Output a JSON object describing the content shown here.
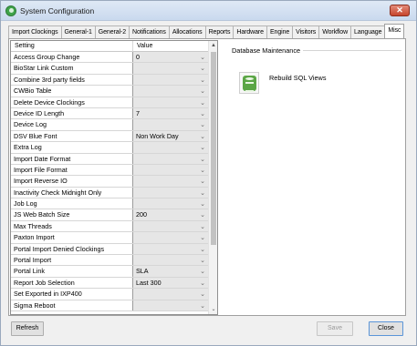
{
  "window": {
    "title": "System Configuration",
    "close_glyph": "✕"
  },
  "tabs": [
    {
      "label": "Import Clockings",
      "active": false
    },
    {
      "label": "General-1",
      "active": false
    },
    {
      "label": "General-2",
      "active": false
    },
    {
      "label": "Notifications",
      "active": false
    },
    {
      "label": "Allocations",
      "active": false
    },
    {
      "label": "Reports",
      "active": false
    },
    {
      "label": "Hardware",
      "active": false
    },
    {
      "label": "Engine",
      "active": false
    },
    {
      "label": "Visitors",
      "active": false
    },
    {
      "label": "Workflow",
      "active": false
    },
    {
      "label": "Language",
      "active": false
    },
    {
      "label": "Misc",
      "active": true
    }
  ],
  "grid": {
    "header_setting": "Setting",
    "header_value": "Value",
    "rows": [
      {
        "setting": "Access Group Change",
        "value": "0"
      },
      {
        "setting": "BioStar Link Custom",
        "value": ""
      },
      {
        "setting": "Combine 3rd party fields",
        "value": ""
      },
      {
        "setting": "CWBio Table",
        "value": ""
      },
      {
        "setting": "Delete Device Clockings",
        "value": ""
      },
      {
        "setting": "Device ID Length",
        "value": "7"
      },
      {
        "setting": "Device Log",
        "value": ""
      },
      {
        "setting": "DSV Blue Font",
        "value": "Non Work Day"
      },
      {
        "setting": "Extra Log",
        "value": ""
      },
      {
        "setting": "Import Date Format",
        "value": ""
      },
      {
        "setting": "Import File Format",
        "value": ""
      },
      {
        "setting": "Import Reverse IO",
        "value": ""
      },
      {
        "setting": "Inactivity Check Midnight Only",
        "value": ""
      },
      {
        "setting": "Job Log",
        "value": ""
      },
      {
        "setting": "JS Web Batch Size",
        "value": "200"
      },
      {
        "setting": "Max Threads",
        "value": ""
      },
      {
        "setting": "Paxton Import",
        "value": ""
      },
      {
        "setting": "Portal Import Denied Clockings",
        "value": ""
      },
      {
        "setting": "Portal Import",
        "value": ""
      },
      {
        "setting": "Portal Link",
        "value": "SLA"
      },
      {
        "setting": "Report Job Selection",
        "value": "Last 300"
      },
      {
        "setting": "Set Exported in IXP400",
        "value": ""
      },
      {
        "setting": "Sigma Reboot",
        "value": ""
      }
    ],
    "dropdown_glyph": "⌄",
    "scroll_up_glyph": "▲",
    "scroll_down_glyph": "⌄"
  },
  "maintenance": {
    "group_title": "Database Maintenance",
    "rebuild_label": "Rebuild SQL Views",
    "icon": "database-icon",
    "icon_color": "#5ba646"
  },
  "buttons": {
    "refresh": "Refresh",
    "save": "Save",
    "close": "Close"
  },
  "colors": {
    "accent_focus": "#5b95d8",
    "title_bar": "#c9d9ee",
    "close_button": "#c6452c"
  }
}
